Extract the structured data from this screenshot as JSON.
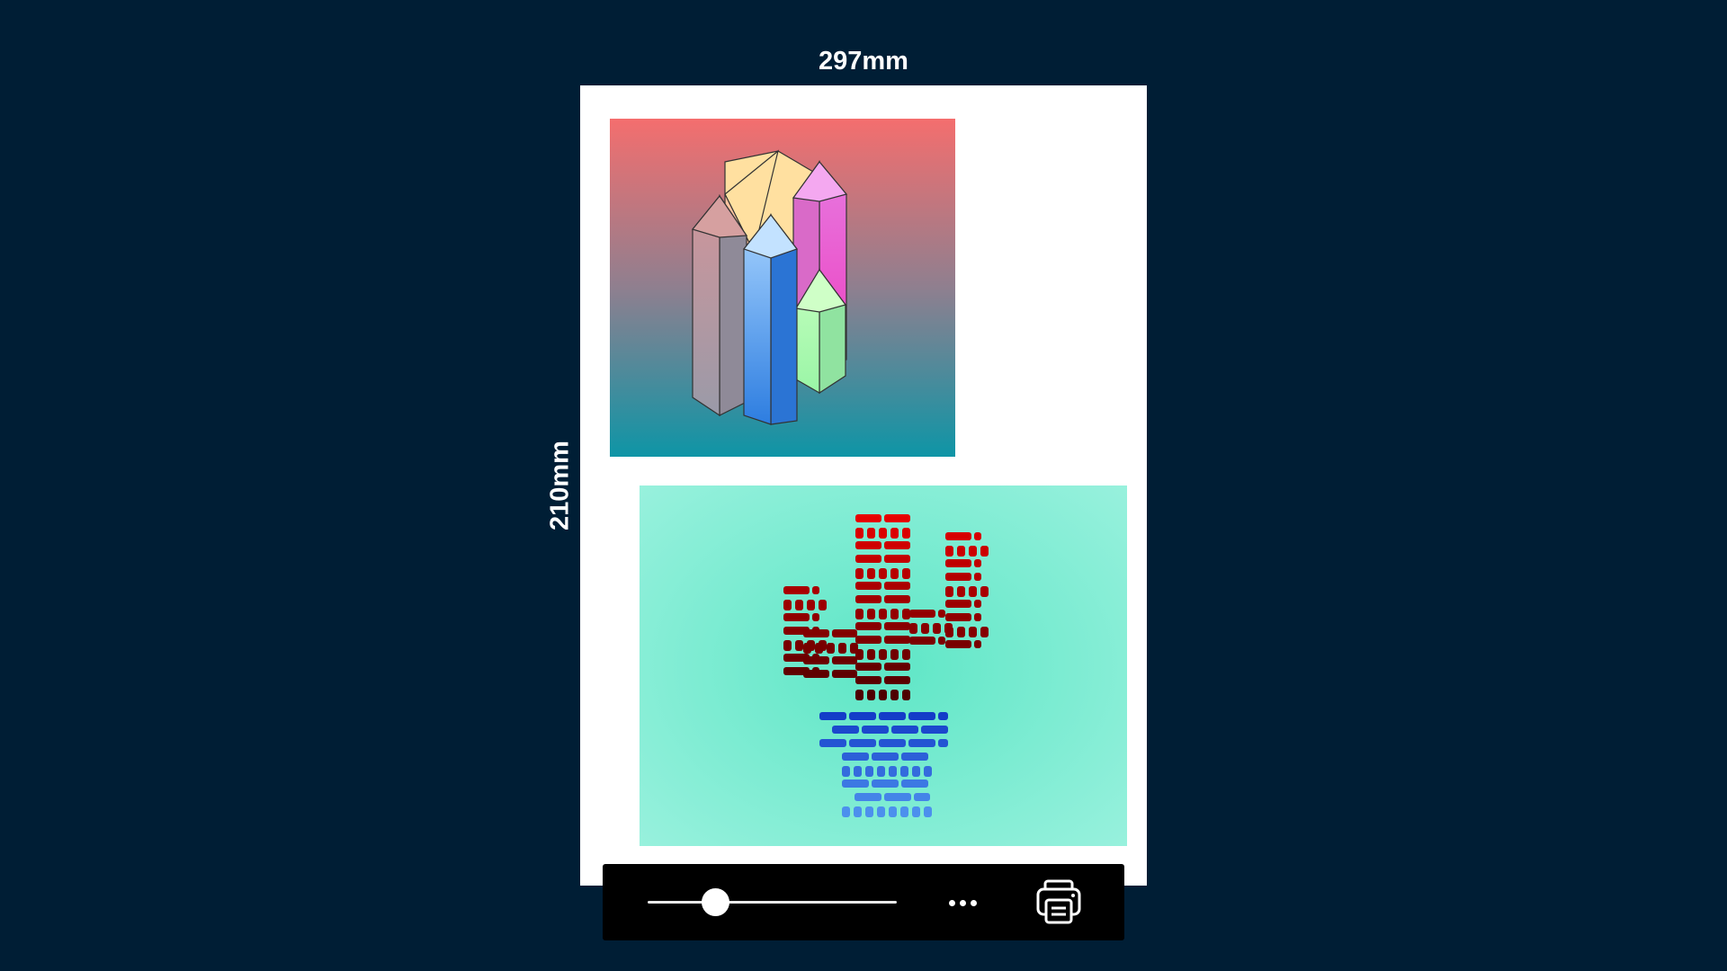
{
  "dimensions": {
    "width_label": "297mm",
    "height_label": "210mm"
  },
  "artworks": [
    {
      "name": "crystals-artwork",
      "icon": "crystal-towers-illustration"
    },
    {
      "name": "cactus-artwork",
      "icon": "brick-cactus-illustration"
    }
  ],
  "toolbar": {
    "zoom_slider_value": 0.27,
    "more_icon": "more-horizontal-icon",
    "print_icon": "printer-icon"
  },
  "colors": {
    "background": "#001e35",
    "page": "#ffffff",
    "toolbar": "#000000"
  }
}
